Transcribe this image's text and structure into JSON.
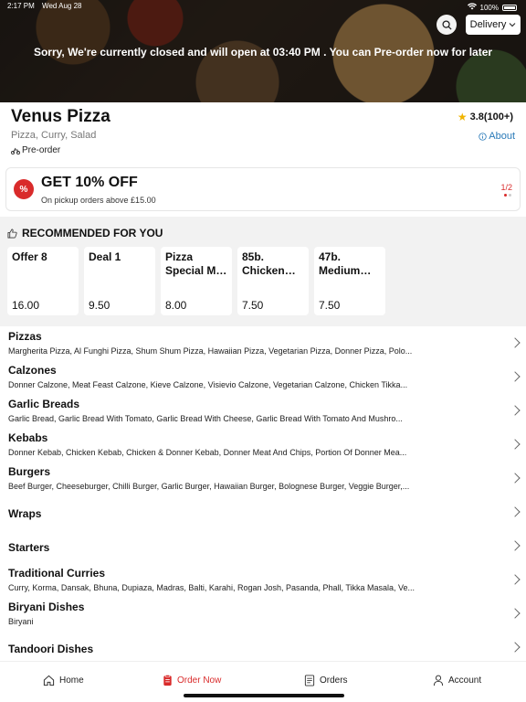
{
  "status_bar": {
    "time": "2:17 PM",
    "date": "Wed Aug 28",
    "battery": "100%"
  },
  "banner": {
    "closed_message": "Sorry, We're currently closed and will open at 03:40 PM . You can Pre-order now for later",
    "delivery_option": "Delivery"
  },
  "restaurant": {
    "name": "Venus Pizza",
    "cuisine": "Pizza, Curry, Salad",
    "preorder": "Pre-order",
    "rating": "3.8(100+)",
    "about": "About"
  },
  "offer": {
    "title": "GET 10% OFF",
    "subtitle": "On pickup orders above £15.00",
    "pager": "1/2",
    "badge": "%"
  },
  "recommended": {
    "title": "RECOMMENDED FOR YOU",
    "items": [
      {
        "name": "Offer 8",
        "price": "16.00"
      },
      {
        "name": "Deal 1",
        "price": "9.50"
      },
      {
        "name": "Pizza Special M…",
        "price": "8.00"
      },
      {
        "name": "85b. Chicken K…",
        "price": "7.50"
      },
      {
        "name": "47b. Medium…",
        "price": "7.50"
      }
    ]
  },
  "categories": [
    {
      "name": "Pizzas",
      "items": "Margherita Pizza, Al Funghi Pizza, Shum Shum Pizza, Hawaiian Pizza, Vegetarian Pizza, Donner Pizza, Polo..."
    },
    {
      "name": "Calzones",
      "items": "Donner Calzone, Meat Feast Calzone, Kieve Calzone, Visievio Calzone, Vegetarian Calzone, Chicken Tikka..."
    },
    {
      "name": "Garlic Breads",
      "items": "Garlic Bread, Garlic Bread With Tomato, Garlic Bread With Cheese, Garlic Bread With Tomato And Mushro..."
    },
    {
      "name": "Kebabs",
      "items": "Donner Kebab, Chicken Kebab, Chicken & Donner Kebab, Donner Meat And Chips, Portion Of Donner Mea..."
    },
    {
      "name": "Burgers",
      "items": "Beef Burger, Cheeseburger, Chilli Burger, Garlic Burger, Hawaiian Burger, Bolognese Burger, Veggie Burger,..."
    },
    {
      "name": "Wraps",
      "items": ""
    },
    {
      "name": "Starters",
      "items": ""
    },
    {
      "name": "Traditional Curries",
      "items": "Curry, Korma, Dansak, Bhuna, Dupiaza, Madras, Balti, Karahi, Rogan Josh, Pasanda, Phall, Tikka Masala, Ve..."
    },
    {
      "name": "Biryani Dishes",
      "items": "Biryani"
    },
    {
      "name": "Tandoori Dishes",
      "items": ""
    }
  ],
  "nav": {
    "home": "Home",
    "order_now": "Order Now",
    "orders": "Orders",
    "account": "Account"
  },
  "colors": {
    "accent": "#d92b2b",
    "link": "#2a7ab8",
    "star": "#f0b400"
  }
}
